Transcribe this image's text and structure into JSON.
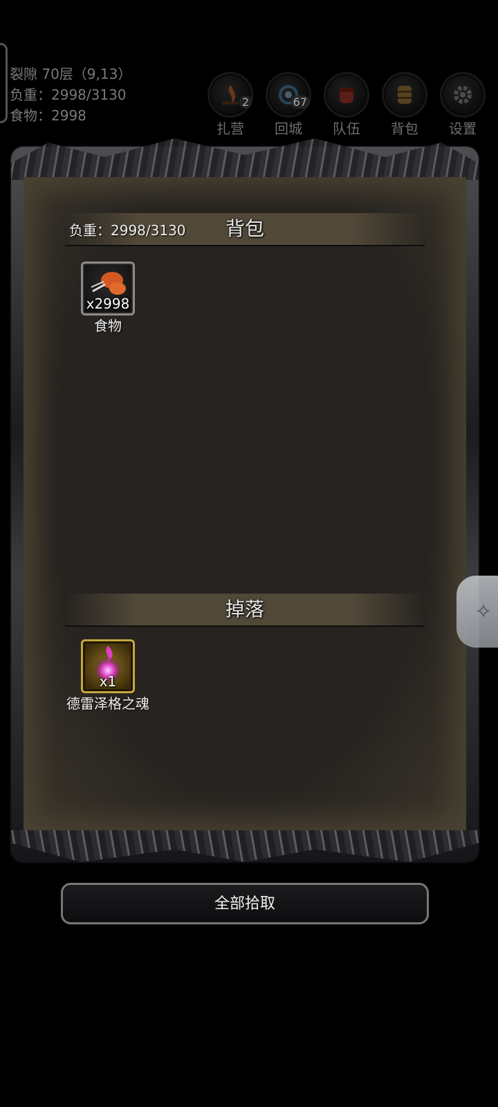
{
  "status": {
    "location": "裂隙 70层（9,13）",
    "load": "负重：2998/3130",
    "food": "食物：2998"
  },
  "menu": [
    {
      "label": "扎营",
      "icon": "campfire-icon",
      "badge": "2"
    },
    {
      "label": "回城",
      "icon": "portal-icon",
      "badge": "67"
    },
    {
      "label": "队伍",
      "icon": "fist-icon",
      "badge": ""
    },
    {
      "label": "背包",
      "icon": "barrel-icon",
      "badge": ""
    },
    {
      "label": "设置",
      "icon": "gear-icon",
      "badge": ""
    }
  ],
  "backpack": {
    "load_label": "负重：2998/3130",
    "title": "背包",
    "items": [
      {
        "qty": "x2998",
        "name": "食物",
        "icon": "meat-icon"
      }
    ]
  },
  "drops": {
    "title": "掉落",
    "items": [
      {
        "qty": "x1",
        "name": "德雷泽格之魂",
        "icon": "soul-orb-icon"
      }
    ]
  },
  "pickup_all": "全部拾取",
  "colors": {
    "panel_bg": "#262320",
    "soul_border": "#c7a73b",
    "food_border": "#8c8c8c"
  }
}
